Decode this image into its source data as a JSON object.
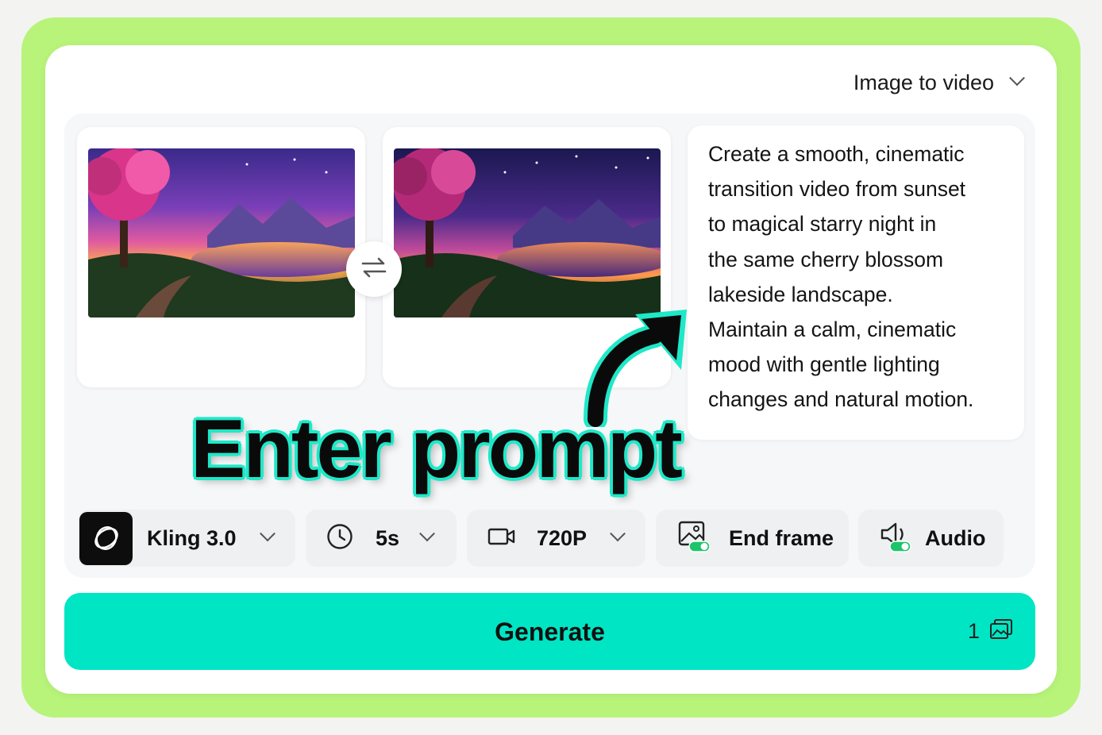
{
  "mode_selector": {
    "label": "Image to video",
    "icon": "chevron-down-icon"
  },
  "frames": {
    "start": {
      "description_icon": "image-thumbnail"
    },
    "end": {
      "description_icon": "image-thumbnail"
    },
    "swap_icon": "swap-arrows-icon"
  },
  "prompt": {
    "text": "Create a smooth, cinematic\ntransition video from sunset\nto magical starry night in\nthe same cherry blossom\nlakeside landscape.\nMaintain a calm, cinematic\nmood with gentle lighting\nchanges and natural motion."
  },
  "annotation": {
    "text": "Enter prompt",
    "color": "#1ee8c8"
  },
  "toolbar": {
    "model": {
      "label": "Kling 3.0",
      "icon": "kling-logo-icon"
    },
    "duration": {
      "label": "5s",
      "icon": "clock-icon"
    },
    "resolution": {
      "label": "720P",
      "icon": "video-camera-icon"
    },
    "end_frame": {
      "label": "End frame",
      "icon": "image-toggle-icon"
    },
    "audio": {
      "label": "Audio",
      "icon": "speaker-toggle-icon"
    }
  },
  "generate": {
    "label": "Generate",
    "credits": "1",
    "icon": "images-icon"
  },
  "colors": {
    "accent": "#00e5c3",
    "frame_bg": "#b8f47a",
    "toggle_on": "#1ec46a"
  }
}
